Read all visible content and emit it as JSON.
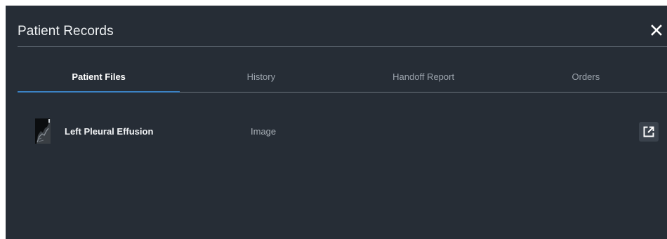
{
  "window": {
    "title": "Patient Records"
  },
  "icons": {
    "close": "close-icon",
    "open": "external-link-icon"
  },
  "tabs": [
    {
      "label": "Patient Files",
      "active": true
    },
    {
      "label": "History",
      "active": false
    },
    {
      "label": "Handoff Report",
      "active": false
    },
    {
      "label": "Orders",
      "active": false
    }
  ],
  "files": [
    {
      "name": "Left Pleural Effusion",
      "type": "Image"
    }
  ],
  "colors": {
    "background": "#262d36",
    "accent": "#3b82c4"
  }
}
